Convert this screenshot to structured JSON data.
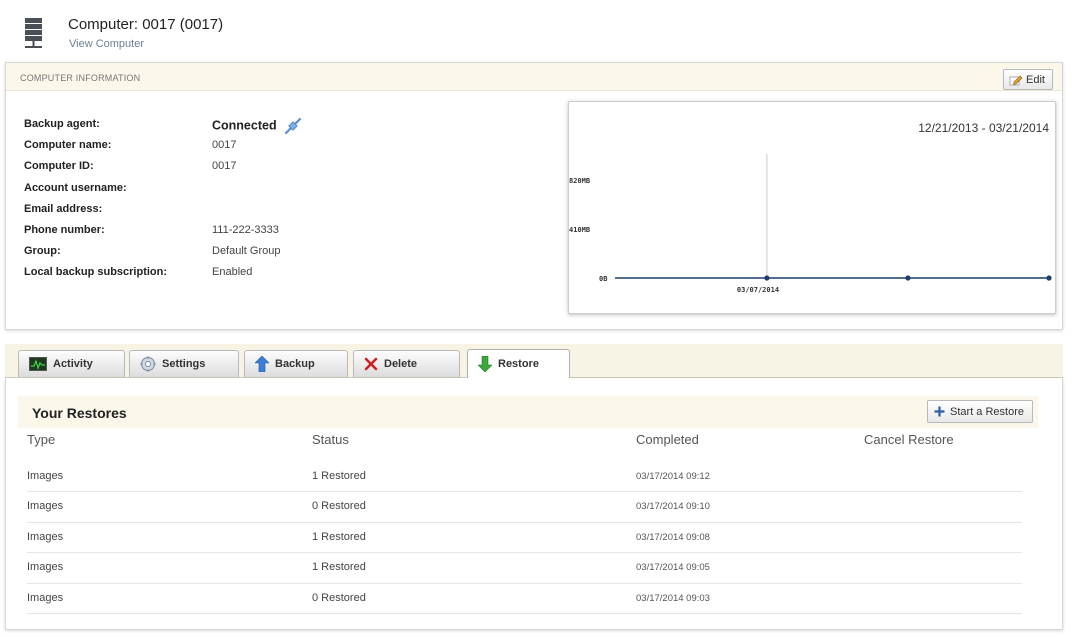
{
  "header": {
    "title": "Computer: 0017 (0017)",
    "subtitle_link": "View Computer"
  },
  "info_panel": {
    "section_label": "COMPUTER INFORMATION",
    "edit_label": "Edit",
    "fields": [
      {
        "label": "Backup agent:",
        "value": "Connected"
      },
      {
        "label": "Computer name:",
        "value": "0017"
      },
      {
        "label": "Computer ID:",
        "value": "0017"
      },
      {
        "label": "Account username:",
        "value": ""
      },
      {
        "label": "Email address:",
        "value": ""
      },
      {
        "label": "Phone number:",
        "value": "111-222-3333"
      },
      {
        "label": "Group:",
        "value": "Default Group"
      },
      {
        "label": "Local backup subscription:",
        "value": "Enabled"
      }
    ]
  },
  "chart_data": {
    "type": "line",
    "title": "12/21/2013 - 03/21/2014",
    "y_tick_labels": [
      "820MB",
      "410MB",
      "0B"
    ],
    "x_tick_labels": [
      "03/07/2014"
    ],
    "series": [
      {
        "values": [
          0,
          0,
          0
        ]
      }
    ],
    "grid": false,
    "colors": {
      "line": "#1c3f6e",
      "axis": "#333333"
    }
  },
  "tabs": [
    {
      "label": "Activity",
      "icon": "activity-monitor-icon",
      "active": false
    },
    {
      "label": "Settings",
      "icon": "gear-icon",
      "active": false
    },
    {
      "label": "Backup",
      "icon": "arrow-up-icon",
      "active": false
    },
    {
      "label": "Delete",
      "icon": "close-x-icon",
      "active": false
    },
    {
      "label": "Restore",
      "icon": "arrow-down-icon",
      "active": true
    }
  ],
  "restores": {
    "title": "Your Restores",
    "start_button": "Start a Restore",
    "columns": [
      "Type",
      "Status",
      "Completed",
      "Cancel Restore"
    ],
    "rows": [
      {
        "type": "Images",
        "status": "1 Restored",
        "completed": "03/17/2014 09:12"
      },
      {
        "type": "Images",
        "status": "0 Restored",
        "completed": "03/17/2014 09:10"
      },
      {
        "type": "Images",
        "status": "1 Restored",
        "completed": "03/17/2014 09:08"
      },
      {
        "type": "Images",
        "status": "1 Restored",
        "completed": "03/17/2014 09:05"
      },
      {
        "type": "Images",
        "status": "0 Restored",
        "completed": "03/17/2014 09:03"
      }
    ]
  },
  "colors": {
    "panel_header_bg": "#fbf7ea",
    "delete_red": "#cc2222",
    "arrow_blue": "#3a7fd5",
    "arrow_green": "#3aa83a"
  }
}
